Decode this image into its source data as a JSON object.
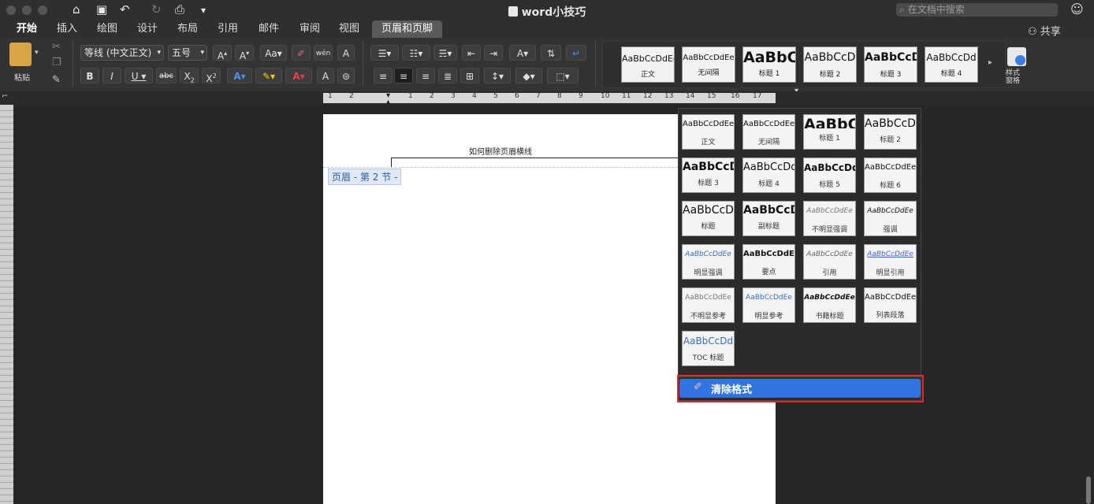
{
  "window": {
    "title": "word小技巧",
    "search_placeholder": "在文档中搜索",
    "share_label": "共享"
  },
  "tabs": [
    "开始",
    "插入",
    "绘图",
    "设计",
    "布局",
    "引用",
    "邮件",
    "审阅",
    "视图",
    "页眉和页脚"
  ],
  "ribbon": {
    "paste_label": "粘贴",
    "font_name": "等线 (中文正文)",
    "font_size": "五号",
    "styles_pane_label": "样式\n窗格",
    "style_gallery": [
      {
        "sample": "AaBbCcDdEe",
        "name": "正文"
      },
      {
        "sample": "AaBbCcDdEe",
        "name": "无间隔"
      },
      {
        "sample": "AaBbC",
        "name": "标题 1"
      },
      {
        "sample": "AaBbCcD",
        "name": "标题 2"
      },
      {
        "sample": "AaBbCcD",
        "name": "标题 3"
      },
      {
        "sample": "AaBbCcDd",
        "name": "标题 4"
      }
    ]
  },
  "ruler": {
    "ticks": [
      "1",
      "2",
      "1",
      "2",
      "3",
      "4",
      "5",
      "6",
      "7",
      "8",
      "9",
      "10",
      "11",
      "12",
      "13",
      "14",
      "15",
      "16",
      "17"
    ]
  },
  "document": {
    "header_text": "如何删除页眉横线",
    "header_tag": "页眉 - 第 2 节 -"
  },
  "styles_dropdown": {
    "items": [
      {
        "sample": "AaBbCcDdEe",
        "name": "正文"
      },
      {
        "sample": "AaBbCcDdEe",
        "name": "无间隔"
      },
      {
        "sample": "AaBbC",
        "name": "标题 1"
      },
      {
        "sample": "AaBbCcD",
        "name": "标题 2"
      },
      {
        "sample": "AaBbCcD",
        "name": "标题 3"
      },
      {
        "sample": "AaBbCcDd",
        "name": "标题 4"
      },
      {
        "sample": "AaBbCcDd",
        "name": "标题 5"
      },
      {
        "sample": "AaBbCcDdEe",
        "name": "标题 6"
      },
      {
        "sample": "AaBbCcD",
        "name": "标题"
      },
      {
        "sample": "AaBbCcD",
        "name": "副标题"
      },
      {
        "sample": "AaBbCcDdEe",
        "name": "不明显强调"
      },
      {
        "sample": "AaBbCcDdEe",
        "name": "强调"
      },
      {
        "sample": "AaBbCcDdEe",
        "name": "明显强调"
      },
      {
        "sample": "AaBbCcDdEe",
        "name": "要点"
      },
      {
        "sample": "AaBbCcDdEe",
        "name": "引用"
      },
      {
        "sample": "AaBbCcDdEe",
        "name": "明显引用"
      },
      {
        "sample": "AaBbCcDdEe",
        "name": "不明显参考"
      },
      {
        "sample": "AaBbCcDdEe",
        "name": "明显参考"
      },
      {
        "sample": "AaBbCcDdEe",
        "name": "书籍标题"
      },
      {
        "sample": "AaBbCcDdEe",
        "name": "列表段落"
      },
      {
        "sample": "AaBbCcDd",
        "name": "TOC 标题"
      }
    ],
    "clear_formatting_label": "清除格式"
  },
  "colors": {
    "highlight": "#2f74e0",
    "outline": "#e0282a",
    "accent": "#1e6fe0"
  }
}
